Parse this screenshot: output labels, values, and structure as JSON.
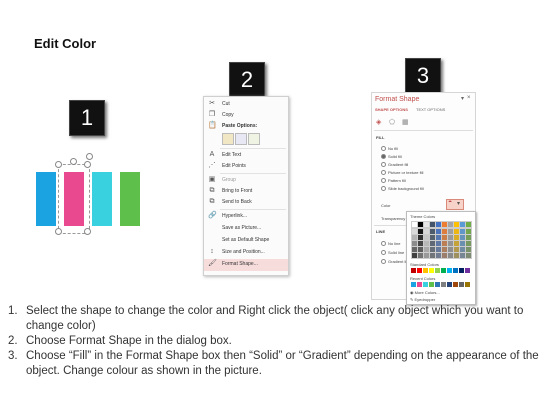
{
  "title": "Edit Color",
  "steps": [
    "1",
    "2",
    "3"
  ],
  "context_menu": {
    "items": [
      {
        "label": "Cut",
        "icon": "scissors-icon"
      },
      {
        "label": "Copy",
        "icon": "copy-icon"
      },
      {
        "label": "Paste Options:",
        "icon": "paste-icon"
      },
      {
        "label": "",
        "icon": "paste-options-icons"
      },
      {
        "label": "Edit Text",
        "icon": "edit-text-icon"
      },
      {
        "label": "Edit Points",
        "icon": "edit-points-icon"
      },
      {
        "label": "Group",
        "icon": "group-icon"
      },
      {
        "label": "Bring to Front",
        "icon": "bring-front-icon"
      },
      {
        "label": "Send to Back",
        "icon": "send-back-icon"
      },
      {
        "label": "Hyperlink...",
        "icon": "hyperlink-icon"
      },
      {
        "label": "Save as Picture...",
        "icon": ""
      },
      {
        "label": "Set as Default Shape",
        "icon": ""
      },
      {
        "label": "Size and Position...",
        "icon": "size-position-icon"
      },
      {
        "label": "Format Shape...",
        "icon": "format-shape-icon"
      }
    ]
  },
  "format_pane": {
    "title": "Format Shape",
    "tab_shape": "SHAPE OPTIONS",
    "tab_text": "TEXT OPTIONS",
    "fill_heading": "FILL",
    "fill_options": [
      "No fill",
      "Solid fill",
      "Gradient fill",
      "Picture or texture fill",
      "Pattern fill",
      "Slide background fill"
    ],
    "color_label": "Color",
    "transparency_label": "Transparency",
    "line_heading": "LINE",
    "line_options": [
      "No line",
      "Solid line",
      "Gradient line"
    ],
    "theme_colors_label": "Theme Colors",
    "standard_colors_label": "Standard Colors",
    "recent_colors_label": "Recent Colors",
    "more_colors": "More Colors...",
    "eyedropper": "Eyedropper"
  },
  "bar_colors": [
    "#1aa3e0",
    "#e8498f",
    "#39d0e0",
    "#5fbf4b"
  ],
  "instructions": [
    {
      "num": "1.",
      "text": "Select the shape to change the color and Right click the object( click any object which you want to change color)"
    },
    {
      "num": "2.",
      "text": "Choose Format Shape in the dialog box."
    },
    {
      "num": "3.",
      "text": "Choose “Fill” in the Format Shape box then “Solid” or “Gradient” depending on the appearance of the object. Change colour as shown in the picture."
    }
  ]
}
